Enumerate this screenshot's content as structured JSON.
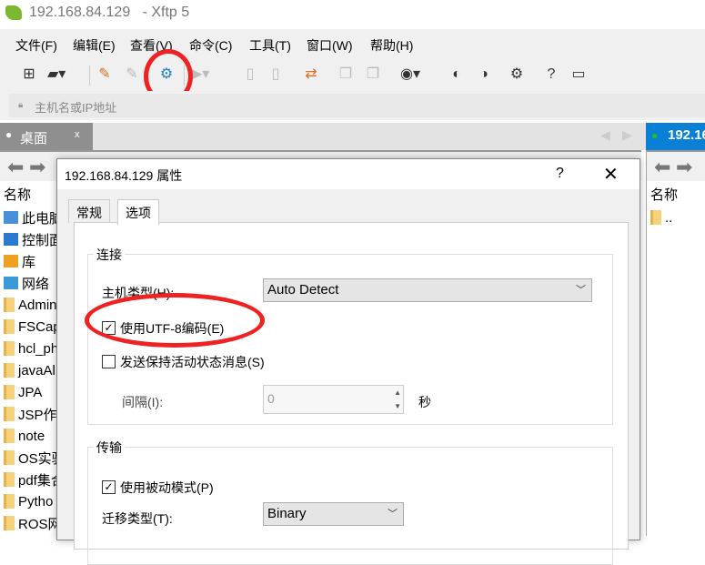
{
  "window": {
    "title": "192.168.84.129",
    "app": "- Xftp 5"
  },
  "menu": [
    "文件(F)",
    "编辑(E)",
    "查看(V)",
    "命令(C)",
    "工具(T)",
    "窗口(W)",
    "帮助(H)"
  ],
  "address": {
    "placeholder": "主机名或IP地址"
  },
  "tabs": {
    "left": "桌面",
    "left_close": "x",
    "right": "192.16"
  },
  "left_pane": {
    "header": "名称",
    "items": [
      "此电脑",
      "控制面",
      "库",
      "网络",
      "Admin",
      "FSCap",
      "hcl_ph",
      "javaAl",
      "JPA",
      "JSP作",
      "note",
      "OS实验",
      "pdf集合",
      "Pytho",
      "ROS网"
    ]
  },
  "right_pane": {
    "header": "名称",
    "items": [
      ".."
    ]
  },
  "dialog": {
    "title": "192.168.84.129 属性",
    "help": "?",
    "close": "✕",
    "tabs": [
      "常规",
      "选项"
    ],
    "connection": {
      "label": "连接",
      "host_type_label": "主机类型(H):",
      "host_type_value": "Auto Detect",
      "utf8_label": "使用UTF-8编码(E)",
      "utf8_checked": true,
      "keepalive_label": "发送保持活动状态消息(S)",
      "keepalive_checked": false,
      "interval_label": "间隔(I):",
      "interval_value": "0",
      "interval_unit": "秒"
    },
    "transfer": {
      "label": "传输",
      "passive_label": "使用被动模式(P)",
      "passive_checked": true,
      "mode_label": "迁移类型(T):",
      "mode_value": "Binary"
    }
  },
  "colors": {
    "accent": "#0a7fd6",
    "highlight": "#ee2222"
  }
}
